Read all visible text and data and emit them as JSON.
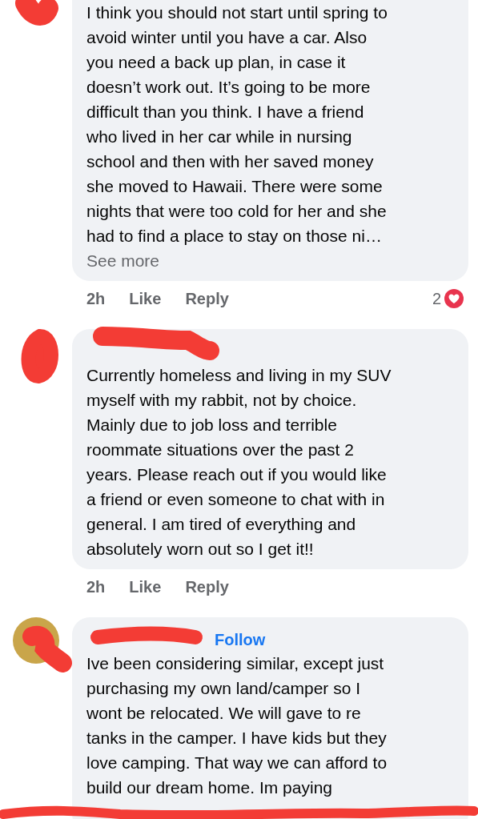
{
  "comments": [
    {
      "lines": [
        "I think you should not start until spring to",
        "avoid winter until you have a car.  Also",
        "you need a back up plan, in case it",
        "doesn’t work out.  It’s going to be more",
        "difficult than you think.  I have a friend",
        "who lived in her car while in nursing",
        "school and then with her saved money",
        "she moved to Hawaii.  There were some",
        "nights that were too cold for her and she",
        "had to find a place to stay on those ni…"
      ],
      "see_more": "See more",
      "time": "2h",
      "like": "Like",
      "reply": "Reply",
      "reaction_count": "2"
    },
    {
      "lines": [
        "Currently homeless and living in my SUV",
        "myself with my rabbit, not by choice.",
        "Mainly due to job loss and terrible",
        "roommate situations over the past 2",
        "years. Please reach out if you would like",
        "a friend or even someone to chat with in",
        "general. I am tired of everything and",
        "absolutely worn out so I get it!!"
      ],
      "time": "2h",
      "like": "Like",
      "reply": "Reply"
    },
    {
      "follow": "Follow",
      "lines": [
        "Ive been considering similar, except just",
        "purchasing my own land/camper so I",
        "wont be relocated. We will gave to re",
        "tanks in the camper. I have kids but they",
        "love camping. That way we can afford to",
        "build our dream home. Im paying"
      ]
    }
  ]
}
